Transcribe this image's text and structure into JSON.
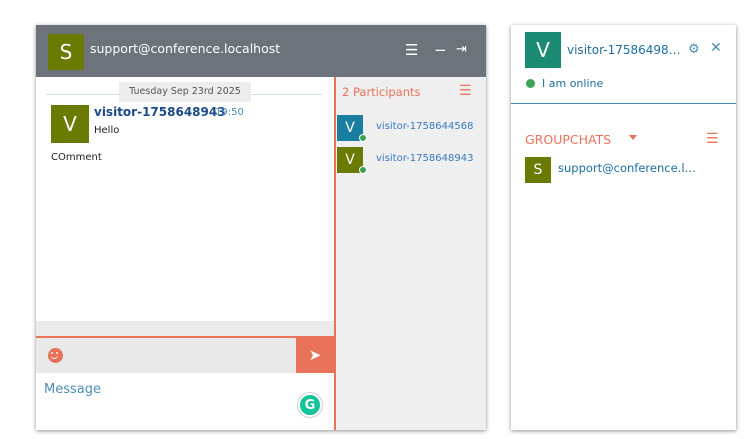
{
  "chatroom": {
    "header": {
      "avatar_letter": "S",
      "title": "support@conference.localhost",
      "menu_icon": "☰",
      "minimize_icon": "−",
      "leave_icon": "⇥"
    },
    "date_separator": "Tuesday Sep 23rd 2025",
    "messages": [
      {
        "avatar_letter": "V",
        "author": "visitor-1758648943",
        "time": "19:50",
        "lines": [
          "Hello",
          "COmment"
        ]
      }
    ],
    "composer": {
      "placeholder": "Message",
      "emoji_icon": "smiley-icon",
      "send_icon": "➤",
      "grammarly_letter": "G"
    },
    "participants": {
      "title": "2 Participants",
      "menu_icon": "☰",
      "list": [
        {
          "letter": "V",
          "name": "visitor-1758644568",
          "color": "#1a7ea0"
        },
        {
          "letter": "V",
          "name": "visitor-1758648943",
          "color": "#6b7a00"
        }
      ]
    }
  },
  "controlbox": {
    "avatar_letter": "V",
    "username": "visitor-17586498…",
    "gear_icon": "⚙",
    "close_icon": "✕",
    "status": "I am online",
    "groupchats_title": "GROUPCHATS",
    "groupchats_menu_icon": "☰",
    "rooms": [
      {
        "letter": "S",
        "name": "support@conference.l…"
      }
    ]
  },
  "colors": {
    "accent": "#e8725a",
    "header_gray": "#6c737b",
    "link_blue": "#1b6fa3",
    "olive": "#6b7a00",
    "teal": "#1a8a72",
    "online": "#3aa655"
  }
}
